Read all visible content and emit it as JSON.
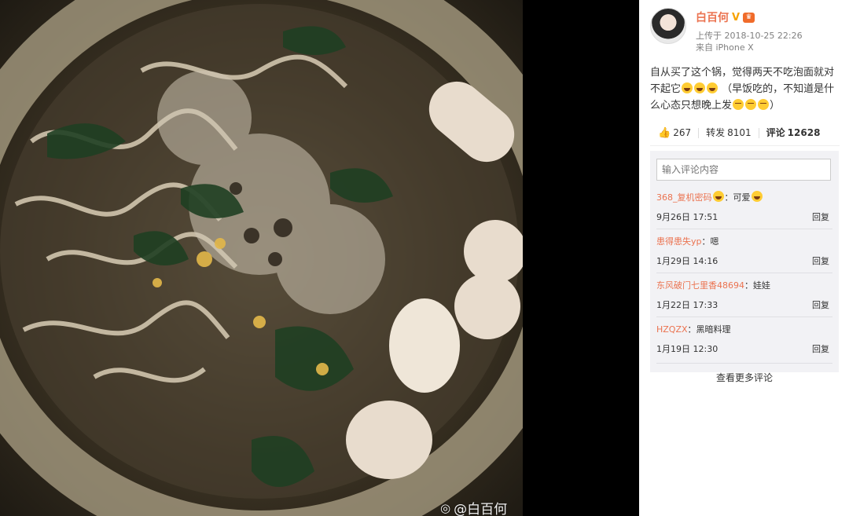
{
  "watermark": {
    "icon": "weibo-logo-icon",
    "text": "@白百何"
  },
  "author": {
    "name": "白百何",
    "verified_icon": "V",
    "member_icon": "crown",
    "uploaded": "上传于 2018-10-25 22:26",
    "source": "来自 iPhone X"
  },
  "post": {
    "text_part1": "自从买了这个锅，觉得两天不吃泡面就对不起它",
    "text_part2": "（早饭吃的，不知道是什么心态只想晚上发",
    "text_part3": "）"
  },
  "stats": {
    "likes": "267",
    "repost_label": "转发",
    "reposts": "8101",
    "comment_label": "评论",
    "comments": "12628"
  },
  "comment_box": {
    "placeholder": "输入评论内容"
  },
  "comments": [
    {
      "user": "368_复机密码",
      "text": "可爱",
      "time": "9月26日 17:51",
      "reply": "回复"
    },
    {
      "user": "患得患失yp",
      "text": "嗯",
      "time": "1月29日 14:16",
      "reply": "回复"
    },
    {
      "user": "东风破门七里香48694",
      "text": "娃娃",
      "time": "1月22日 17:33",
      "reply": "回复"
    },
    {
      "user": "HZQZX",
      "text": "黑暗料理",
      "time": "1月19日 12:30",
      "reply": "回复"
    }
  ],
  "more_comments": "查看更多评论",
  "colors": {
    "accent": "#eb7350",
    "panel_bg": "#ffffff",
    "comments_bg": "#f2f2f5"
  }
}
